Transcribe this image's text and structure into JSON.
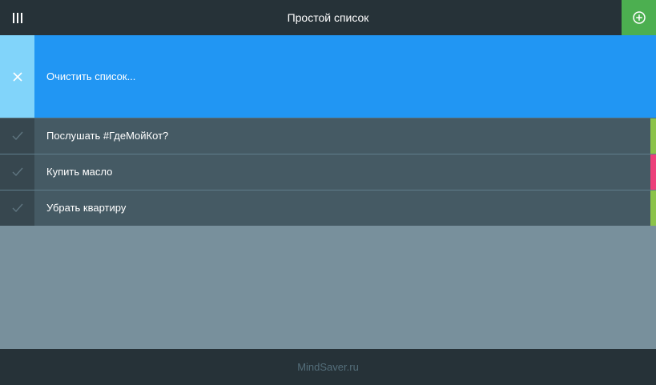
{
  "header": {
    "title": "Простой список",
    "menu_icon": "menu-bars-icon",
    "add_icon": "plus-circle-icon",
    "add_color": "#4caf50"
  },
  "clear": {
    "label": "Очистить список...",
    "icon": "close-icon",
    "color": "#2196f3"
  },
  "items": [
    {
      "label": "Послушать #ГдеМойКот?",
      "tag_color": "#8bc34a",
      "done": false
    },
    {
      "label": "Купить масло",
      "tag_color": "#ec407a",
      "done": false
    },
    {
      "label": "Убрать квартиру",
      "tag_color": "#8bc34a",
      "done": false
    }
  ],
  "footer": {
    "text": "MindSaver.ru"
  }
}
